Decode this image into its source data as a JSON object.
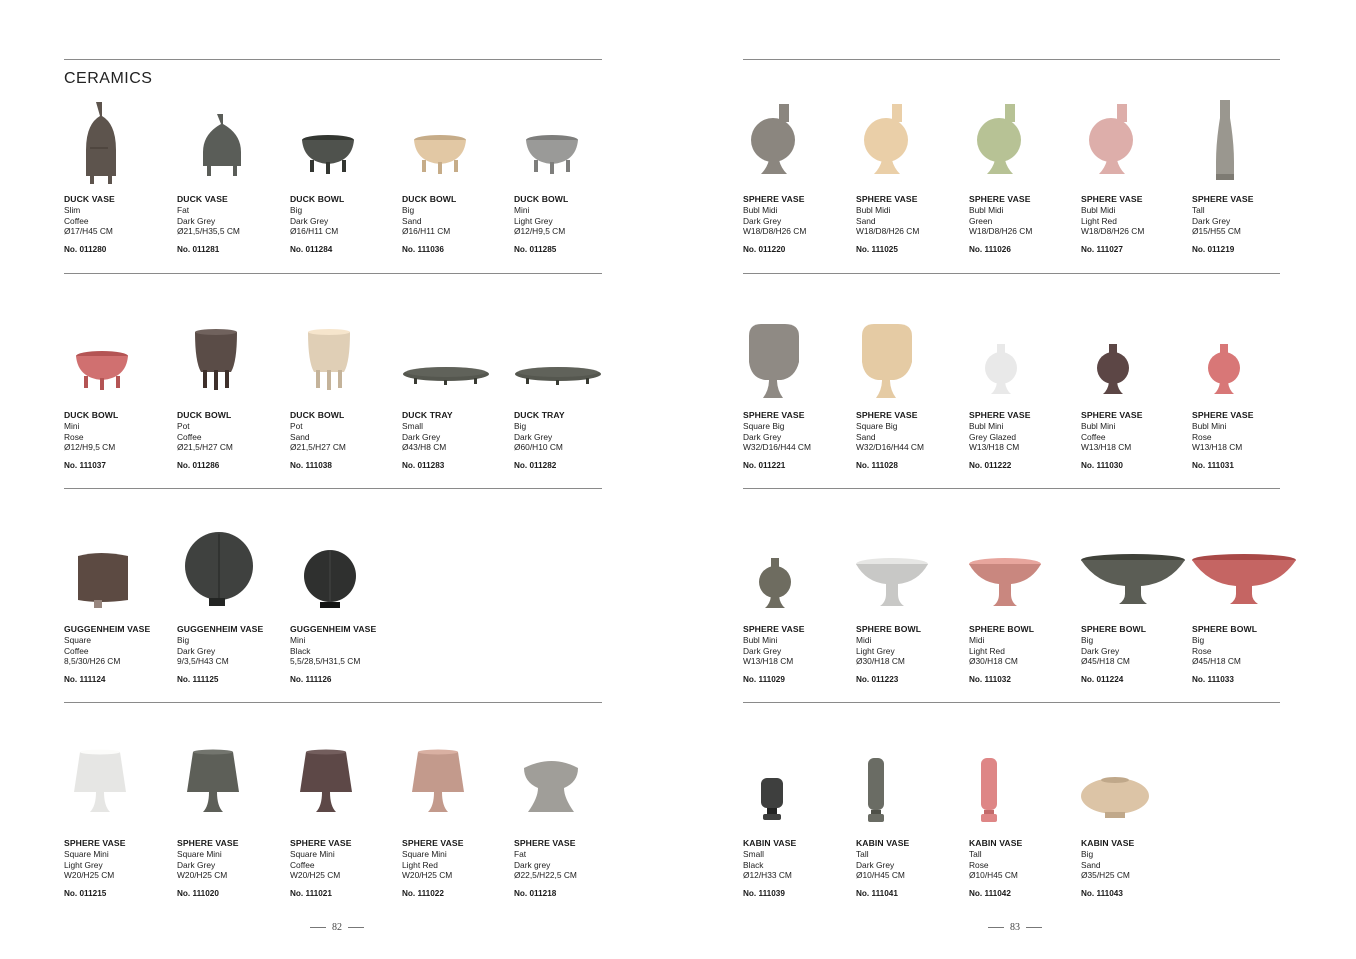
{
  "left_page": {
    "section_title": "CERAMICS",
    "page_number": "82",
    "rows": [
      [
        {
          "name": "DUCK VASE",
          "variant": "Slim",
          "color": "Coffee",
          "size": "Ø17/H45 CM",
          "no": "No. 011280",
          "shape": "duck-vase-slim",
          "hex": "#5d544d"
        },
        {
          "name": "DUCK VASE",
          "variant": "Fat",
          "color": "Dark Grey",
          "size": "Ø21,5/H35,5 CM",
          "no": "No. 011281",
          "shape": "duck-vase-fat",
          "hex": "#5a5d58"
        },
        {
          "name": "DUCK BOWL",
          "variant": "Big",
          "color": "Dark Grey",
          "size": "Ø16/H11 CM",
          "no": "No. 011284",
          "shape": "duck-bowl",
          "hex": "#4f524d"
        },
        {
          "name": "DUCK BOWL",
          "variant": "Big",
          "color": "Sand",
          "size": "Ø16/H11 CM",
          "no": "No. 111036",
          "shape": "duck-bowl",
          "hex": "#e2c8a4"
        },
        {
          "name": "DUCK BOWL",
          "variant": "Mini",
          "color": "Light Grey",
          "size": "Ø12/H9,5 CM",
          "no": "No. 011285",
          "shape": "duck-bowl",
          "hex": "#9a9a98"
        }
      ],
      [
        {
          "name": "DUCK BOWL",
          "variant": "Mini",
          "color": "Rose",
          "size": "Ø12/H9,5 CM",
          "no": "No. 111037",
          "shape": "duck-bowl",
          "hex": "#d07070"
        },
        {
          "name": "DUCK BOWL",
          "variant": "Pot",
          "color": "Coffee",
          "size": "Ø21,5/H27 CM",
          "no": "No. 011286",
          "shape": "duck-pot",
          "hex": "#5a4c47"
        },
        {
          "name": "DUCK BOWL",
          "variant": "Pot",
          "color": "Sand",
          "size": "Ø21,5/H27 CM",
          "no": "No. 111038",
          "shape": "duck-pot",
          "hex": "#e0cfb6"
        },
        {
          "name": "DUCK TRAY",
          "variant": "Small",
          "color": "Dark Grey",
          "size": "Ø43/H8 CM",
          "no": "No. 011283",
          "shape": "tray",
          "hex": "#55574f"
        },
        {
          "name": "DUCK TRAY",
          "variant": "Big",
          "color": "Dark Grey",
          "size": "Ø60/H10 CM",
          "no": "No. 011282",
          "shape": "tray",
          "hex": "#55574f"
        }
      ],
      [
        {
          "name": "GUGGENHEIM VASE",
          "variant": "Square",
          "color": "Coffee",
          "size": "8,5/30/H26 CM",
          "no": "No. 111124",
          "shape": "gugg-square",
          "hex": "#5c4a42"
        },
        {
          "name": "GUGGENHEIM VASE",
          "variant": "Big",
          "color": "Dark Grey",
          "size": "9/3,5/H43 CM",
          "no": "No. 111125",
          "shape": "gugg-round",
          "hex": "#3f413f"
        },
        {
          "name": "GUGGENHEIM VASE",
          "variant": "Mini",
          "color": "Black",
          "size": "5,5/28,5/H31,5 CM",
          "no": "No. 111126",
          "shape": "gugg-round-mini",
          "hex": "#2f302f"
        }
      ],
      [
        {
          "name": "SPHERE VASE",
          "variant": "Square Mini",
          "color": "Light Grey",
          "size": "W20/H25 CM",
          "no": "No. 011215",
          "shape": "sphere-square-mini",
          "hex": "#e6e6e4"
        },
        {
          "name": "SPHERE VASE",
          "variant": "Square Mini",
          "color": "Dark Grey",
          "size": "W20/H25 CM",
          "no": "No. 111020",
          "shape": "sphere-square-mini",
          "hex": "#5d5f58"
        },
        {
          "name": "SPHERE VASE",
          "variant": "Square Mini",
          "color": "Coffee",
          "size": "W20/H25 CM",
          "no": "No. 111021",
          "shape": "sphere-square-mini",
          "hex": "#5d4847"
        },
        {
          "name": "SPHERE VASE",
          "variant": "Square Mini",
          "color": "Light Red",
          "size": "W20/H25 CM",
          "no": "No. 111022",
          "shape": "sphere-square-mini",
          "hex": "#c39a8c"
        },
        {
          "name": "SPHERE VASE",
          "variant": "Fat",
          "color": "Dark grey",
          "size": "Ø22,5/H22,5 CM",
          "no": "No. 011218",
          "shape": "sphere-fat",
          "hex": "#a09e99"
        }
      ]
    ]
  },
  "right_page": {
    "page_number": "83",
    "rows": [
      [
        {
          "name": "SPHERE VASE",
          "variant": "Bubl Midi",
          "color": "Dark Grey",
          "size": "W18/D8/H26 CM",
          "no": "No. 011220",
          "shape": "sphere-bubl",
          "hex": "#8b867f"
        },
        {
          "name": "SPHERE VASE",
          "variant": "Bubl Midi",
          "color": "Sand",
          "size": "W18/D8/H26 CM",
          "no": "No. 111025",
          "shape": "sphere-bubl",
          "hex": "#eacfa8"
        },
        {
          "name": "SPHERE VASE",
          "variant": "Bubl Midi",
          "color": "Green",
          "size": "W18/D8/H26 CM",
          "no": "No. 111026",
          "shape": "sphere-bubl",
          "hex": "#b7c295"
        },
        {
          "name": "SPHERE VASE",
          "variant": "Bubl Midi",
          "color": "Light Red",
          "size": "W18/D8/H26 CM",
          "no": "No. 111027",
          "shape": "sphere-bubl",
          "hex": "#ddaeaa"
        },
        {
          "name": "SPHERE VASE",
          "variant": "Tall",
          "color": "Dark Grey",
          "size": "Ø15/H55 CM",
          "no": "No. 011219",
          "shape": "sphere-tall",
          "hex": "#9a978f"
        }
      ],
      [
        {
          "name": "SPHERE VASE",
          "variant": "Square Big",
          "color": "Dark Grey",
          "size": "W32/D16/H44 CM",
          "no": "No. 011221",
          "shape": "sphere-square-big",
          "hex": "#8f8a84"
        },
        {
          "name": "SPHERE VASE",
          "variant": "Square Big",
          "color": "Sand",
          "size": "W32/D16/H44 CM",
          "no": "No. 111028",
          "shape": "sphere-square-big",
          "hex": "#e5cba4"
        },
        {
          "name": "SPHERE VASE",
          "variant": "Bubl Mini",
          "color": "Grey Glazed",
          "size": "W13/H18 CM",
          "no": "No. 011222",
          "shape": "sphere-bubl-mini",
          "hex": "#e9e9e9"
        },
        {
          "name": "SPHERE VASE",
          "variant": "Bubl Mini",
          "color": "Coffee",
          "size": "W13/H18 CM",
          "no": "No. 111030",
          "shape": "sphere-bubl-mini",
          "hex": "#5c4645"
        },
        {
          "name": "SPHERE VASE",
          "variant": "Bubl Mini",
          "color": "Rose",
          "size": "W13/H18 CM",
          "no": "No. 111031",
          "shape": "sphere-bubl-mini",
          "hex": "#d87777"
        }
      ],
      [
        {
          "name": "SPHERE VASE",
          "variant": "Bubl Mini",
          "color": "Dark Grey",
          "size": "W13/H18 CM",
          "no": "No. 111029",
          "shape": "sphere-bubl-mini",
          "hex": "#6e6c60"
        },
        {
          "name": "SPHERE BOWL",
          "variant": "Midi",
          "color": "Light Grey",
          "size": "Ø30/H18 CM",
          "no": "No. 011223",
          "shape": "sphere-bowl-midi",
          "hex": "#c8c8c6"
        },
        {
          "name": "SPHERE BOWL",
          "variant": "Midi",
          "color": "Light Red",
          "size": "Ø30/H18 CM",
          "no": "No. 111032",
          "shape": "sphere-bowl-midi",
          "hex": "#c9877f"
        },
        {
          "name": "SPHERE BOWL",
          "variant": "Big",
          "color": "Dark Grey",
          "size": "Ø45/H18 CM",
          "no": "No. 011224",
          "shape": "sphere-bowl-big",
          "hex": "#5b5d55"
        },
        {
          "name": "SPHERE BOWL",
          "variant": "Big",
          "color": "Rose",
          "size": "Ø45/H18 CM",
          "no": "No. 111033",
          "shape": "sphere-bowl-big",
          "hex": "#c56563"
        }
      ],
      [
        {
          "name": "KABIN VASE",
          "variant": "Small",
          "color": "Black",
          "size": "Ø12/H33 CM",
          "no": "No. 111039",
          "shape": "kabin-small",
          "hex": "#3e3f3e"
        },
        {
          "name": "KABIN VASE",
          "variant": "Tall",
          "color": "Dark Grey",
          "size": "Ø10/H45 CM",
          "no": "No. 111041",
          "shape": "kabin-tall",
          "hex": "#6a6c64"
        },
        {
          "name": "KABIN VASE",
          "variant": "Tall",
          "color": "Rose",
          "size": "Ø10/H45 CM",
          "no": "No. 111042",
          "shape": "kabin-tall",
          "hex": "#de8686"
        },
        {
          "name": "KABIN VASE",
          "variant": "Big",
          "color": "Sand",
          "size": "Ø35/H25 CM",
          "no": "No. 111043",
          "shape": "kabin-big",
          "hex": "#dcc4a6"
        }
      ]
    ]
  }
}
